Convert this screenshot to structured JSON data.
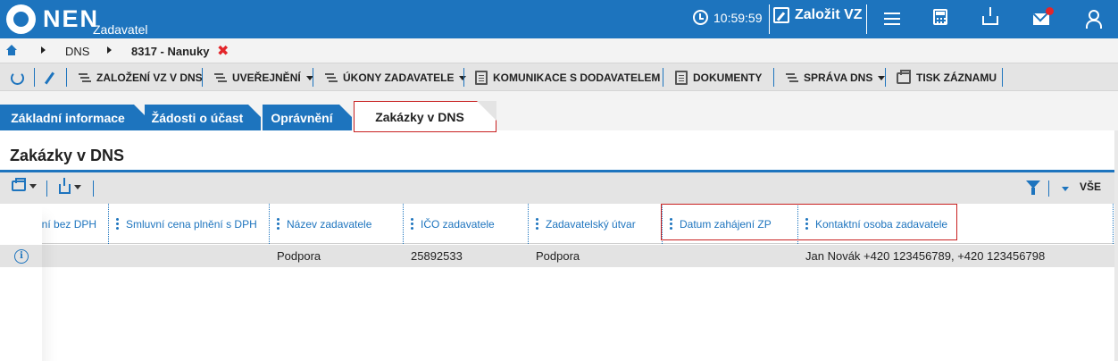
{
  "header": {
    "logo_text": "NEN",
    "logo_sub": "Zadavatel",
    "time": "10:59:59",
    "create_label": "Založit VZ",
    "icons": [
      "menu-icon",
      "calculator-icon",
      "inbox-download-icon",
      "mail-icon",
      "user-icon"
    ],
    "accent_color": "#1d74be",
    "notification_color": "#e3262b"
  },
  "breadcrumb": {
    "items": [
      "DNS",
      "8317 - Nanuky"
    ],
    "close_symbol": "✖"
  },
  "toolbar": {
    "items": [
      {
        "label": "ZALOŽENÍ VZ V DNS",
        "icon": "lines-icon",
        "dropdown": false
      },
      {
        "label": "UVEŘEJNĚNÍ",
        "icon": "lines-icon",
        "dropdown": true
      },
      {
        "label": "ÚKONY ZADAVATELE",
        "icon": "lines-icon",
        "dropdown": true
      },
      {
        "label": "KOMUNIKACE S DODAVATELEM",
        "icon": "document-icon",
        "dropdown": false
      },
      {
        "label": "DOKUMENTY",
        "icon": "document-icon",
        "dropdown": false
      },
      {
        "label": "SPRÁVA DNS",
        "icon": "lines-icon",
        "dropdown": true
      },
      {
        "label": "TISK ZÁZNAMU",
        "icon": "print-icon",
        "dropdown": false
      }
    ]
  },
  "tabs": [
    {
      "label": "Základní informace",
      "active": false
    },
    {
      "label": "Žádosti o účast",
      "active": false
    },
    {
      "label": "Oprávnění",
      "active": false
    },
    {
      "label": "Zakázky v DNS",
      "active": true
    }
  ],
  "section": {
    "title": "Zakázky v DNS",
    "filter_all_label": "VŠE"
  },
  "table": {
    "columns": [
      "ění bez DPH",
      "Smluvní cena plnění s DPH",
      "Název zadavatele",
      "IČO zadavatele",
      "Zadavatelský útvar",
      "Datum zahájení ZP",
      "Kontaktní osoba zadavatele"
    ],
    "rows": [
      {
        "price_without_vat": "",
        "price_with_vat": "",
        "contracting_name": "Podpora",
        "ico": "25892533",
        "unit": "Podpora",
        "start_date": "",
        "contact": "Jan Novák +420 123456789, +420 123456798"
      }
    ]
  }
}
